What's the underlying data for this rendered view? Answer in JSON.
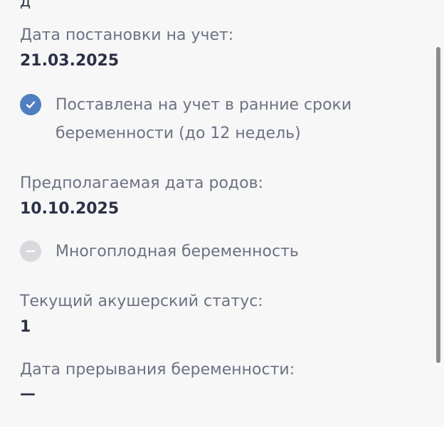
{
  "top_crop": "д",
  "fields": {
    "registration_date_label": "Дата постановки на учет:",
    "registration_date_value": "21.03.2025",
    "early_registration_text": "Поставлена на учет в ранние сроки беременности (до 12 недель)",
    "due_date_label": "Предполагаемая дата родов:",
    "due_date_value": "10.10.2025",
    "multiple_pregnancy_text": "Многоплодная беременность",
    "obstetric_status_label": "Текущий акушерский статус:",
    "obstetric_status_value": "1",
    "termination_date_label": "Дата прерывания беременности:",
    "termination_date_value": "—"
  },
  "states": {
    "early_registration_checked": true,
    "multiple_pregnancy_checked": false
  },
  "colors": {
    "checked": "#4f7fc0",
    "unchecked": "#d8d9dc",
    "label": "#6c7282",
    "value": "#2b3145"
  },
  "icons": {
    "checked": "check-circle-icon",
    "unchecked": "minus-circle-icon"
  }
}
